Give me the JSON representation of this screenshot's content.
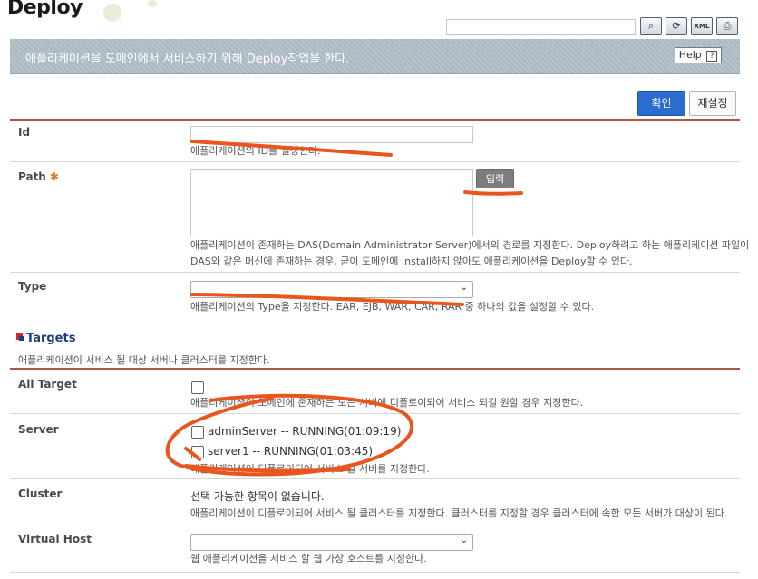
{
  "header": {
    "title": "Deploy",
    "search_value": "",
    "toolbar": [
      {
        "name": "search-icon",
        "glyph": "🔍"
      },
      {
        "name": "refresh-icon",
        "glyph": "⟳"
      },
      {
        "name": "xml-icon",
        "glyph": "XML"
      },
      {
        "name": "export-icon",
        "glyph": "⎙"
      }
    ]
  },
  "banner": {
    "text": "애플리케이션을 도메인에서 서비스하기 위해 Deploy작업을 한다.",
    "help_label": "Help",
    "help_mark": "?"
  },
  "actions": {
    "confirm_label": "확인",
    "reset_label": "재설정"
  },
  "fields": {
    "id": {
      "label": "Id",
      "value": "",
      "desc": "애플리케이션의 ID를 설정한다."
    },
    "path": {
      "label": "Path",
      "required_mark": "✱",
      "value": "",
      "input_button": "입력",
      "desc_line1": "애플리케이션이 존재하는 DAS(Domain Administrator Server)에서의 경로를 지정한다. Deploy하려고 하는 애플리케이션 파일이",
      "desc_line2": "DAS와 같은 머신에 존재하는 경우, 굳이 도메인에 Install하지 않아도 애플리케이션을 Deploy할 수 있다."
    },
    "type": {
      "label": "Type",
      "selected": "",
      "desc": "애플리케이션의 Type을 지정한다. EAR, EJB, WAR, CAR, RAR 중 하나의 값을 설정할 수 있다."
    }
  },
  "targets": {
    "title": "Targets",
    "subtitle": "애플리케이션이 서비스 될 대상 서버나 클러스터를 지정한다.",
    "all_target": {
      "label": "All Target",
      "checked": false,
      "desc": "애플리케이션이 도메인에 존재하는 모든 서버에 디플로이되어 서비스 되길 원할 경우 지정한다."
    },
    "server": {
      "label": "Server",
      "options": [
        {
          "label": "adminServer -- RUNNING(01:09:19)",
          "checked": false
        },
        {
          "label": "server1 -- RUNNING(01:03:45)",
          "checked": false
        }
      ],
      "desc": "애플리케이션이 디플로이되어 서비스 될 서버를 지정한다."
    },
    "cluster": {
      "label": "Cluster",
      "empty_text": "선택 가능한 항목이 없습니다.",
      "desc": "애플리케이션이 디플로이되어 서비스 될 클러스터를 지정한다. 클러스터를 지정할 경우 클러스터에 속한 모든 서버가 대상이 된다."
    },
    "virtual_host": {
      "label": "Virtual Host",
      "selected": "",
      "desc": "웹 애플리케이션을 서비스 할 웹 가상 호스트를 지정한다."
    }
  },
  "colors": {
    "accent": "#2d6ccf",
    "banner": "#a9b7c1",
    "annotation": "#e8561d"
  }
}
